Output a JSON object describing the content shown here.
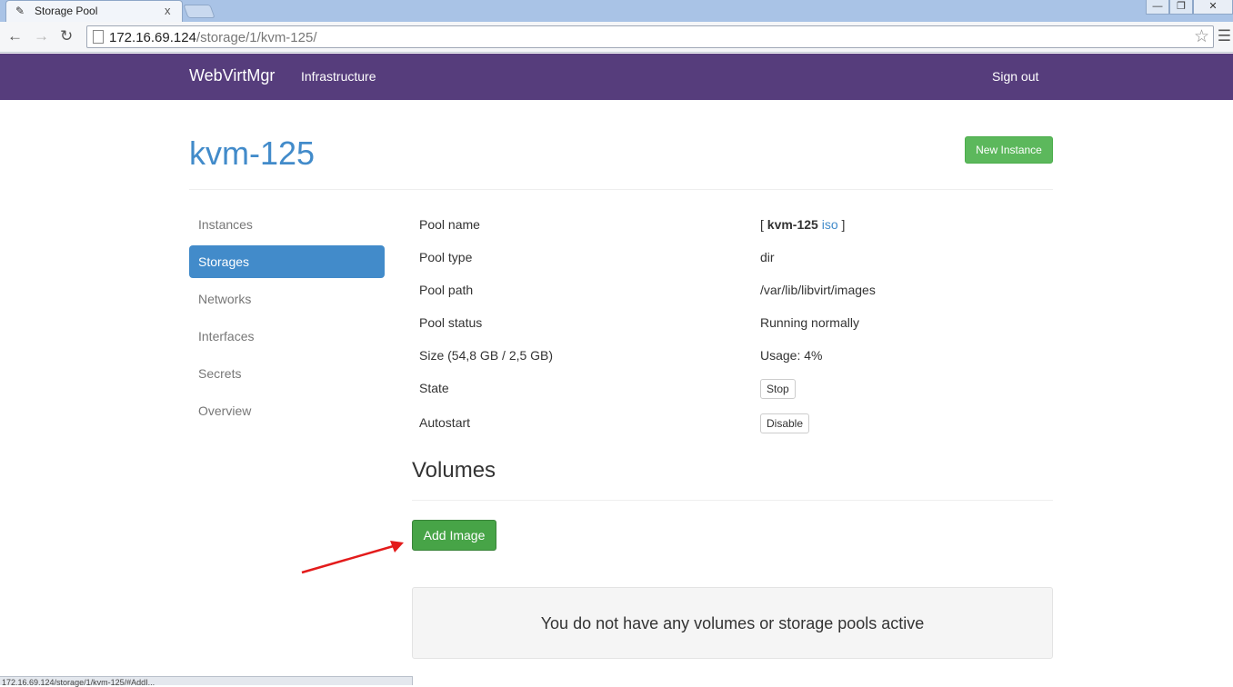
{
  "browser": {
    "tab_title": "Storage Pool",
    "tab_close": "x",
    "url_host": "172.16.69.124",
    "url_path": "/storage/1/kvm-125/",
    "status_text": "172.16.69.124/storage/1/kvm-125/#AddI..."
  },
  "navbar": {
    "brand": "WebVirtMgr",
    "infrastructure": "Infrastructure",
    "sign_out": "Sign out"
  },
  "page": {
    "title": "kvm-125",
    "new_instance": "New Instance"
  },
  "sidebar": {
    "items": [
      {
        "label": "Instances",
        "active": false
      },
      {
        "label": "Storages",
        "active": true
      },
      {
        "label": "Networks",
        "active": false
      },
      {
        "label": "Interfaces",
        "active": false
      },
      {
        "label": "Secrets",
        "active": false
      },
      {
        "label": "Overview",
        "active": false
      }
    ]
  },
  "pool": {
    "name_label": "Pool name",
    "name_open": "[ ",
    "name_value": "kvm-125",
    "name_type": "iso",
    "name_close": " ]",
    "type_label": "Pool type",
    "type_value": "dir",
    "path_label": "Pool path",
    "path_value": "/var/lib/libvirt/images",
    "status_label": "Pool status",
    "status_value": "Running normally",
    "size_label": "Size (54,8 GB / 2,5 GB)",
    "usage_value": "Usage: 4%",
    "state_label": "State",
    "state_button": "Stop",
    "autostart_label": "Autostart",
    "autostart_button": "Disable"
  },
  "volumes": {
    "title": "Volumes",
    "add_button": "Add Image",
    "empty_message": "You do not have any volumes or storage pools active"
  },
  "colors": {
    "navbar": "#563d7c",
    "primary": "#428bca",
    "success": "#5cb85c",
    "arrow": "#e31b1b"
  }
}
